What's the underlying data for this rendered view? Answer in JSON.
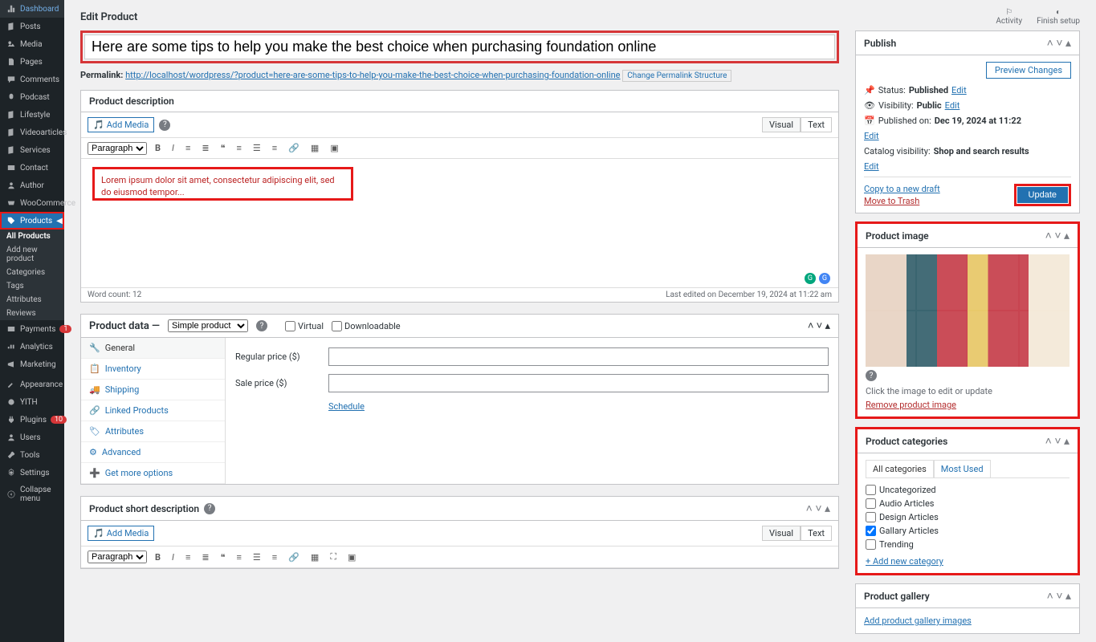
{
  "sidebar": {
    "items": [
      {
        "label": "Dashboard"
      },
      {
        "label": "Posts"
      },
      {
        "label": "Media"
      },
      {
        "label": "Pages"
      },
      {
        "label": "Comments"
      },
      {
        "label": "Podcast"
      },
      {
        "label": "Lifestyle"
      },
      {
        "label": "Videoarticles"
      },
      {
        "label": "Services"
      },
      {
        "label": "Contact"
      },
      {
        "label": "Author"
      },
      {
        "label": "WooCommerce"
      },
      {
        "label": "Products"
      }
    ],
    "submenu": [
      {
        "label": "All Products"
      },
      {
        "label": "Add new product"
      },
      {
        "label": "Categories"
      },
      {
        "label": "Tags"
      },
      {
        "label": "Attributes"
      },
      {
        "label": "Reviews"
      }
    ],
    "items2": [
      {
        "label": "Payments",
        "badge": "1"
      },
      {
        "label": "Analytics"
      },
      {
        "label": "Marketing"
      },
      {
        "label": "Appearance"
      },
      {
        "label": "YITH"
      },
      {
        "label": "Plugins",
        "badge": "10"
      },
      {
        "label": "Users"
      },
      {
        "label": "Tools"
      },
      {
        "label": "Settings"
      },
      {
        "label": "Collapse menu"
      }
    ]
  },
  "top": {
    "title": "Edit Product",
    "activity": "Activity",
    "finish": "Finish setup"
  },
  "post": {
    "title": "Here are some tips to help you make the best choice when purchasing foundation online",
    "permalink_label": "Permalink:",
    "permalink_url": "http://localhost/wordpress/?product=here-are-some-tips-to-help-you-make-the-best-choice-when-purchasing-foundation-online",
    "permalink_btn": "Change Permalink Structure"
  },
  "editor": {
    "title": "Product description",
    "add_media": "Add Media",
    "paragraph": "Paragraph",
    "visual": "Visual",
    "text": "Text",
    "content": "Lorem ipsum dolor sit amet, consectetur adipiscing elit, sed do eiusmod tempor...",
    "word_count": "Word count: 12",
    "last_edited": "Last edited on December 19, 2024 at 11:22 am"
  },
  "product_data": {
    "label": "Product data —",
    "type": "Simple product",
    "virtual": "Virtual",
    "downloadable": "Downloadable",
    "tabs": [
      "General",
      "Inventory",
      "Shipping",
      "Linked Products",
      "Attributes",
      "Advanced",
      "Get more options"
    ],
    "regular_price": "Regular price ($)",
    "sale_price": "Sale price ($)",
    "schedule": "Schedule"
  },
  "short_desc": {
    "title": "Product short description",
    "add_media": "Add Media"
  },
  "publish": {
    "title": "Publish",
    "preview": "Preview Changes",
    "status_label": "Status:",
    "status": "Published",
    "edit": "Edit",
    "vis_label": "Visibility:",
    "visibility": "Public",
    "pubon_label": "Published on:",
    "published_on": "Dec 19, 2024 at 11:22",
    "cat_vis_label": "Catalog visibility:",
    "catalog_vis": "Shop and search results",
    "copy": "Copy to a new draft",
    "trash": "Move to Trash",
    "update": "Update"
  },
  "product_image": {
    "title": "Product image",
    "click_text": "Click the image to edit or update",
    "remove": "Remove product image"
  },
  "product_categories": {
    "title": "Product categories",
    "tab_all": "All categories",
    "tab_most": "Most Used",
    "items": [
      {
        "label": "Uncategorized",
        "checked": false
      },
      {
        "label": "Audio Articles",
        "checked": false
      },
      {
        "label": "Design Articles",
        "checked": false
      },
      {
        "label": "Gallary Articles",
        "checked": true
      },
      {
        "label": "Trending",
        "checked": false
      }
    ],
    "add": "+ Add new category"
  },
  "product_gallery": {
    "title": "Product gallery",
    "add": "Add product gallery images"
  }
}
